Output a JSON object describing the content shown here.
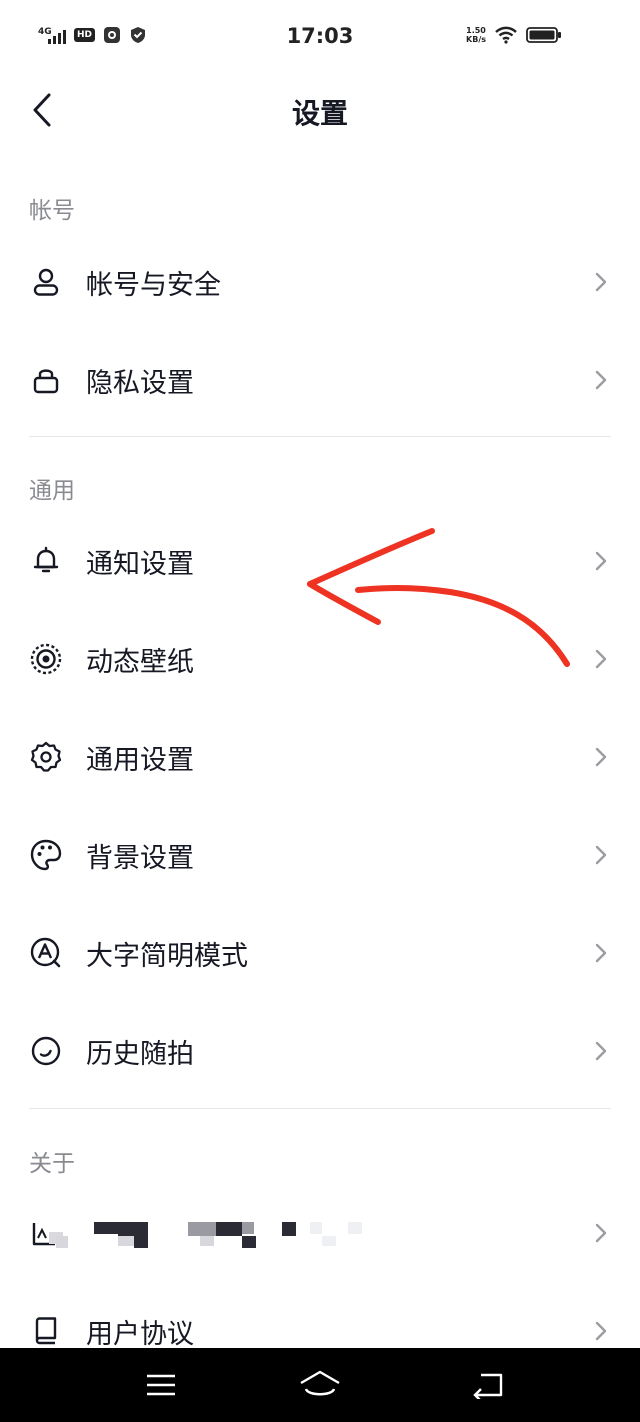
{
  "status_bar": {
    "network": "4G",
    "hd_badge": "HD",
    "time": "17:03",
    "speed_value": "1.50",
    "speed_unit": "KB/s"
  },
  "nav": {
    "title": "设置"
  },
  "sections": [
    {
      "header": "帐号",
      "items": [
        {
          "label": "帐号与安全",
          "icon": "person-icon"
        },
        {
          "label": "隐私设置",
          "icon": "lock-icon"
        }
      ]
    },
    {
      "header": "通用",
      "items": [
        {
          "label": "通知设置",
          "icon": "bell-icon"
        },
        {
          "label": "动态壁纸",
          "icon": "live-wallpaper-icon"
        },
        {
          "label": "通用设置",
          "icon": "gear-icon"
        },
        {
          "label": "背景设置",
          "icon": "palette-icon"
        },
        {
          "label": "大字简明模式",
          "icon": "large-font-icon"
        },
        {
          "label": "历史随拍",
          "icon": "history-icon"
        }
      ]
    },
    {
      "header": "关于",
      "items": [
        {
          "label": "",
          "icon": "app-info-icon"
        },
        {
          "label": "用户协议",
          "icon": "book-icon"
        }
      ]
    }
  ],
  "colors": {
    "text_primary": "#161823",
    "text_secondary": "#8a8b91",
    "divider": "#e6e6e8",
    "annotation_arrow": "#ee3322",
    "system_nav_bg": "#000000"
  }
}
